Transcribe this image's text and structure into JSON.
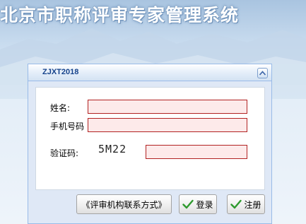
{
  "banner": {
    "title": "北京市职称评审专家管理系统"
  },
  "panel": {
    "title": "ZJXT2018",
    "collapse_icon": "chevron-up-icon"
  },
  "form": {
    "name_label": "姓名:",
    "name_value": "",
    "phone_label": "手机号码",
    "phone_value": "",
    "captcha_label": "验证码:",
    "captcha_text": "5M22",
    "captcha_value": ""
  },
  "buttons": {
    "contact_label": "《评审机构联系方式》",
    "login_label": "登录",
    "register_label": "注册",
    "check_icon": "checkmark-icon"
  },
  "colors": {
    "field_border": "#b22222",
    "field_bg": "#fdeaea",
    "header_text": "#15428b",
    "check_green": "#2e9a2e"
  }
}
